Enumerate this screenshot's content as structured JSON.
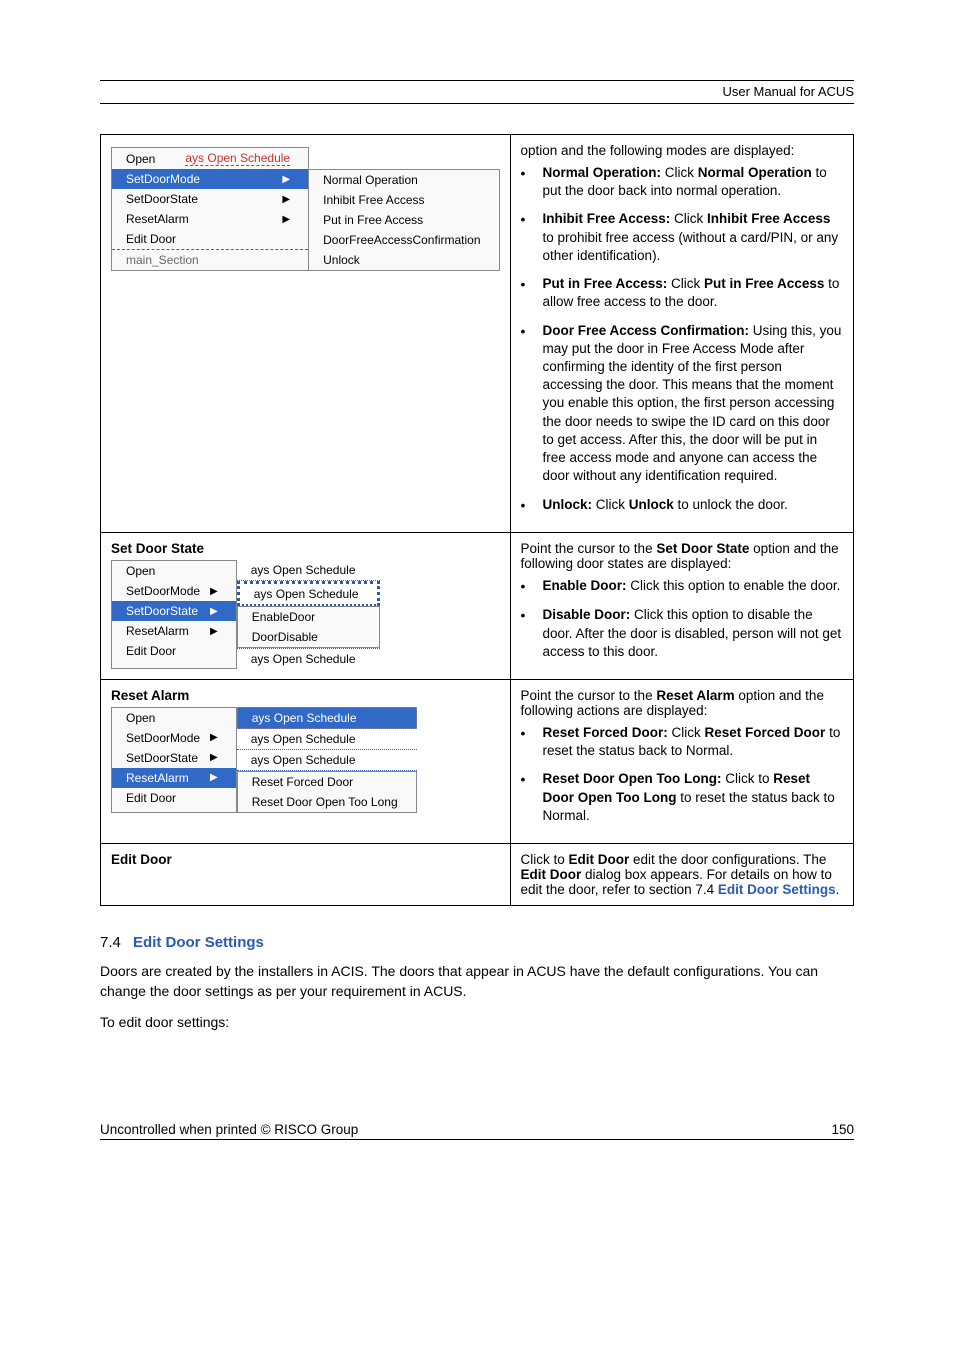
{
  "header": {
    "manual_title": "User Manual for ACUS"
  },
  "row1": {
    "menu": {
      "top_item": "Open",
      "top_right_fragment": "ays Open Schedule",
      "items": [
        {
          "label": "SetDoorMode",
          "hl": true,
          "arrow": true
        },
        {
          "label": "SetDoorState",
          "hl": false,
          "arrow": true
        },
        {
          "label": "ResetAlarm",
          "hl": false,
          "arrow": true
        },
        {
          "label": "Edit Door",
          "hl": false,
          "arrow": false
        }
      ],
      "bottom_fragment": "main_Section",
      "submenu": [
        "Normal Operation",
        "Inhibit Free Access",
        "Put in Free Access",
        "DoorFreeAccessConfirmation",
        "Unlock"
      ]
    },
    "desc": {
      "intro": "option and the following modes are displayed:",
      "bullets": [
        {
          "bold": "Normal Operation:",
          "rest": " Click ",
          "bold2": "Normal Operation",
          "tail": " to put the door back into normal operation."
        },
        {
          "bold": "Inhibit Free Access:",
          "rest": " Click ",
          "bold2": "Inhibit Free Access",
          "tail": " to prohibit free access (without a card/PIN, or any other identification)."
        },
        {
          "bold": "Put in Free Access:",
          "rest": " Click ",
          "bold2": "Put in Free Access",
          "tail": " to allow free access to the door."
        },
        {
          "bold": "Door Free Access Confirmation:",
          "rest": " Using this, you may put the door in Free Access Mode after confirming the identity of the first person accessing the door. This means that the moment you enable this option, the first person accessing the door needs to swipe the ID card on this door to get access. After this, the door will be put in free access mode and anyone can access the door without any identification required."
        },
        {
          "bold": "Unlock:",
          "rest": " Click ",
          "bold2": "Unlock",
          "tail": " to unlock the door."
        }
      ]
    }
  },
  "row2": {
    "title": "Set Door State",
    "menu": {
      "items": [
        {
          "label": "Open",
          "hl": false,
          "arrow": false,
          "side": "ays Open Schedule"
        },
        {
          "label": "SetDoorMode",
          "hl": false,
          "arrow": true,
          "side": "ays Open Schedule"
        },
        {
          "label": "SetDoorState",
          "hl": true,
          "arrow": true
        },
        {
          "label": "ResetAlarm",
          "hl": false,
          "arrow": true
        },
        {
          "label": "Edit Door",
          "hl": false,
          "arrow": false,
          "side": "ays Open Schedule"
        }
      ],
      "submenu": [
        "EnableDoor",
        "DoorDisable"
      ]
    },
    "desc": {
      "intro1": "Point the cursor to the ",
      "intro_bold": "Set Door State",
      "intro2": " option and the following door states are displayed:",
      "bullets": [
        {
          "bold": "Enable Door:",
          "rest": " Click this option to enable the door."
        },
        {
          "bold": "Disable Door:",
          "rest": " Click this option to disable the door. After the door is disabled, person will not get access to this door."
        }
      ]
    }
  },
  "row3": {
    "title": "Reset Alarm",
    "menu": {
      "top_hl_fragment": "ays Open Schedule",
      "items": [
        {
          "label": "Open",
          "hl": false,
          "arrow": false
        },
        {
          "label": "SetDoorMode",
          "hl": false,
          "arrow": true,
          "side": "ays Open Schedule"
        },
        {
          "label": "SetDoorState",
          "hl": false,
          "arrow": true,
          "side": "ays Open Schedule"
        },
        {
          "label": "ResetAlarm",
          "hl": true,
          "arrow": true
        },
        {
          "label": "Edit Door",
          "hl": false,
          "arrow": false
        }
      ],
      "submenu": [
        "Reset Forced Door",
        "Reset Door Open Too Long"
      ]
    },
    "desc": {
      "intro1": "Point the cursor to the ",
      "intro_bold": "Reset Alarm",
      "intro2": " option and the following actions are displayed:",
      "bullets": [
        {
          "bold": "Reset Forced Door:",
          "rest": " Click ",
          "bold2": "Reset Forced Door",
          "tail": " to reset the status back to Normal."
        },
        {
          "bold": "Reset Door Open Too Long:",
          "rest": " Click to ",
          "bold2": "Reset Door Open Too Long",
          "tail": " to reset the status back to Normal."
        }
      ]
    }
  },
  "row4": {
    "title": "Edit Door",
    "desc": {
      "p1": "Click to ",
      "b1": "Edit Door",
      "p2": " edit the door configurations. The ",
      "b2": "Edit Door",
      "p3": " dialog box appears. For details on how to edit the door, refer to section 7.4 ",
      "link": "Edit Door Settings",
      "p4": "."
    }
  },
  "section": {
    "num": "7.4",
    "title": "Edit Door Settings",
    "para1": "Doors are created by the installers in ACIS. The doors that appear in ACUS have the default configurations. You can change the door settings as per your requirement in ACUS.",
    "para2": "To edit door settings:"
  },
  "footer": {
    "left": "Uncontrolled when printed © RISCO Group",
    "right": "150"
  }
}
